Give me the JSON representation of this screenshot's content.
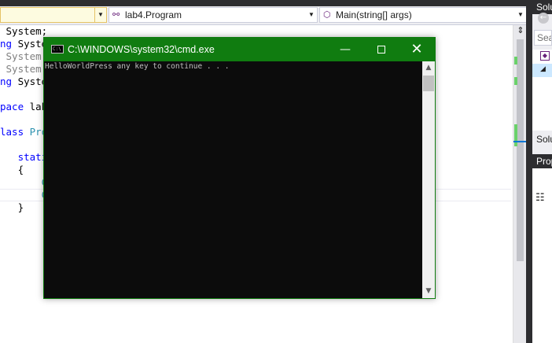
{
  "navigation_bar": {
    "project_combo": "",
    "class_combo": "lab4.Program",
    "member_combo": "Main(string[] args)"
  },
  "editor": {
    "lines": [
      {
        "parts": [
          {
            "t": " System;",
            "c": ""
          }
        ]
      },
      {
        "parts": [
          {
            "t": "ng ",
            "c": "kw"
          },
          {
            "t": "Syste",
            "c": ""
          }
        ]
      },
      {
        "parts": [
          {
            "t": " System.",
            "c": "gr"
          }
        ]
      },
      {
        "parts": [
          {
            "t": " System.",
            "c": "gr"
          }
        ]
      },
      {
        "parts": [
          {
            "t": "ng ",
            "c": "kw"
          },
          {
            "t": "Syste",
            "c": ""
          }
        ]
      },
      {
        "parts": [
          {
            "t": "",
            "c": ""
          }
        ]
      },
      {
        "parts": [
          {
            "t": "pace ",
            "c": "kw"
          },
          {
            "t": "lab",
            "c": ""
          }
        ]
      },
      {
        "parts": [
          {
            "t": "",
            "c": ""
          }
        ]
      },
      {
        "parts": [
          {
            "t": "lass ",
            "c": "kw"
          },
          {
            "t": "Pro",
            "c": "ty"
          }
        ]
      },
      {
        "parts": [
          {
            "t": "",
            "c": ""
          }
        ]
      },
      {
        "parts": [
          {
            "t": "   stati",
            "c": "kw"
          }
        ]
      },
      {
        "parts": [
          {
            "t": "   {",
            "c": ""
          }
        ]
      },
      {
        "parts": [
          {
            "t": "       C",
            "c": "ty"
          }
        ]
      },
      {
        "parts": [
          {
            "t": "       C",
            "c": "ty"
          }
        ]
      },
      {
        "parts": [
          {
            "t": "   }",
            "c": ""
          }
        ]
      }
    ]
  },
  "solution_panel": {
    "header": "Solution Explorer",
    "search_placeholder": "Search Solution Explorer",
    "status_header": "Solution Explorer"
  },
  "properties_panel": {
    "header": "Properties"
  },
  "cmd_window": {
    "title": "C:\\WINDOWS\\system32\\cmd.exe",
    "icon_text": "C:\\",
    "output": "HelloWorldPress any key to continue . . ."
  },
  "colors": {
    "cmd_titlebar": "#107c10",
    "vs_dark": "#2d2d30",
    "keyword": "#0000ff",
    "type": "#2b91af"
  }
}
